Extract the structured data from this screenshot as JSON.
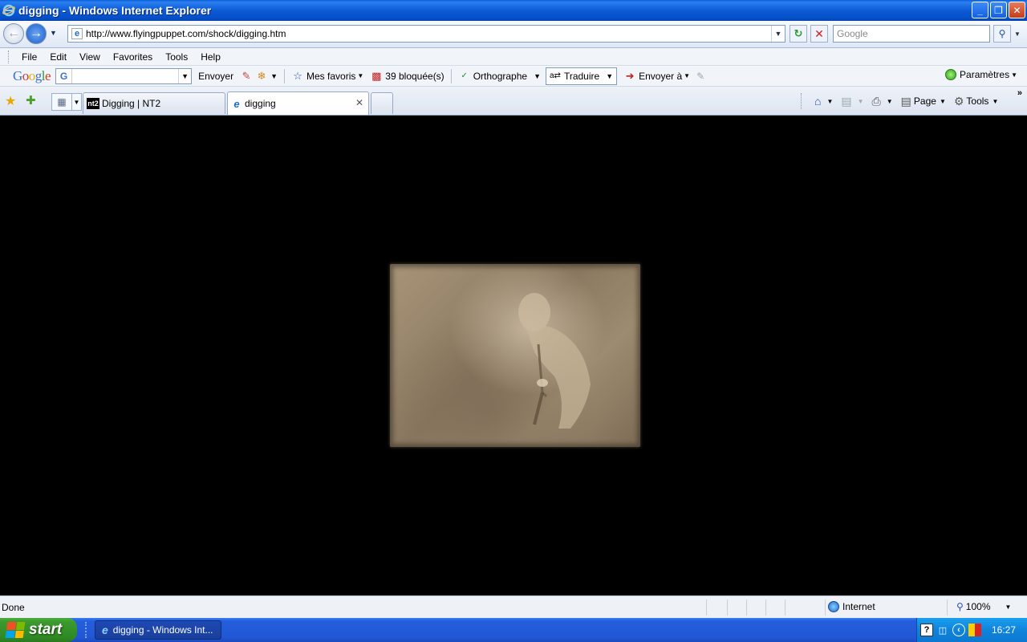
{
  "window": {
    "title": "digging - Windows Internet Explorer",
    "buttons": {
      "minimize": "_",
      "maximize": "❐",
      "close": "✕"
    }
  },
  "nav": {
    "url": "http://www.flyingpuppet.com/shock/digging.htm",
    "search_placeholder": "Google"
  },
  "menu": {
    "items": [
      "File",
      "Edit",
      "View",
      "Favorites",
      "Tools",
      "Help"
    ]
  },
  "google_toolbar": {
    "logo": [
      "G",
      "o",
      "o",
      "g",
      "l",
      "e"
    ],
    "search_letter": "G",
    "envoyer": "Envoyer",
    "mes_favoris": "Mes favoris",
    "bloquees": "39 bloquée(s)",
    "orthographe": "Orthographe",
    "traduire": "Traduire",
    "envoyer_a": "Envoyer à",
    "parametres": "Paramètres"
  },
  "tabs": {
    "items": [
      {
        "label": "Digging | NT2",
        "favicon": "nt2"
      },
      {
        "label": "digging",
        "favicon": "ie-icon"
      }
    ],
    "nt2_icon_text": "nt2"
  },
  "command_bar": {
    "page": "Page",
    "tools": "Tools"
  },
  "status": {
    "text": "Done",
    "zone": "Internet",
    "zoom": "100%"
  },
  "taskbar": {
    "start": "start",
    "task": "digging - Windows Int...",
    "clock": "16:27"
  },
  "colors": {
    "titlebar": "#0b5ad6",
    "taskbar": "#245edc",
    "start": "#3c9a2e",
    "content_bg": "#000000"
  }
}
